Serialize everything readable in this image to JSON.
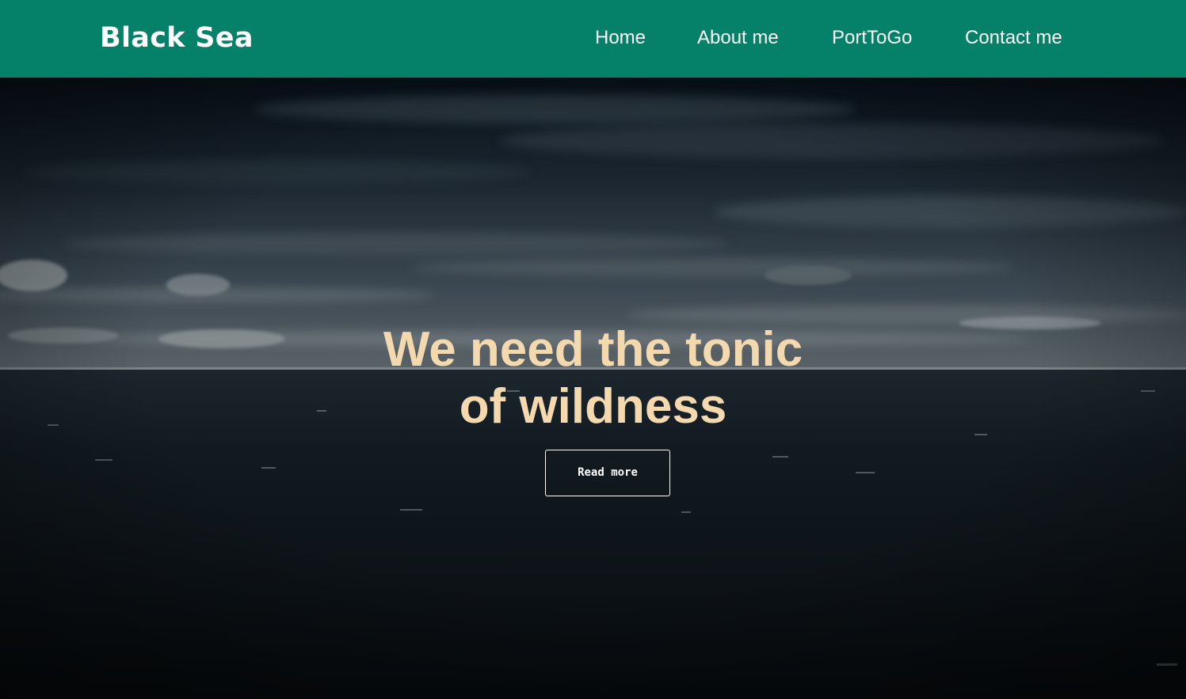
{
  "header": {
    "logo": "Black Sea",
    "nav": [
      "Home",
      "About me",
      "PortToGo",
      "Contact me"
    ]
  },
  "hero": {
    "headline_line1": "We need the tonic",
    "headline_line2": "of wildness",
    "button_label": "Read more"
  },
  "colors": {
    "header_bg": "#048168",
    "headline": "#f4d9ae",
    "text_white": "#ffffff"
  }
}
